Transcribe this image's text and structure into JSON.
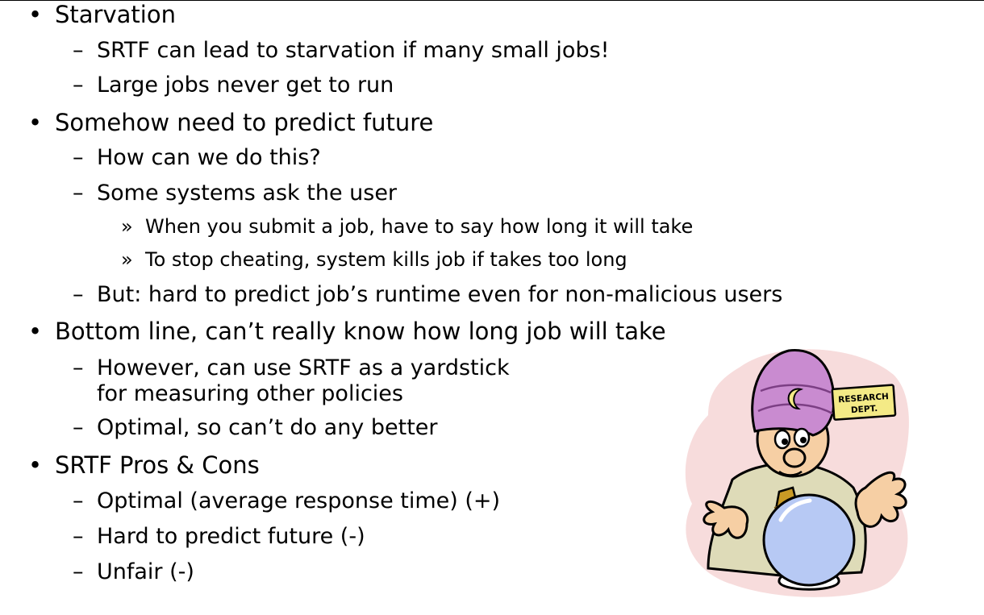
{
  "slide": {
    "items": [
      {
        "level": 1,
        "marker": "•",
        "text": "Starvation"
      },
      {
        "level": 2,
        "marker": "–",
        "text": "SRTF can lead to starvation if many small jobs!"
      },
      {
        "level": 2,
        "marker": "–",
        "text": "Large jobs never get to run"
      },
      {
        "level": 1,
        "marker": "•",
        "text": "Somehow need to predict future"
      },
      {
        "level": 2,
        "marker": "–",
        "text": "How can we do this?"
      },
      {
        "level": 2,
        "marker": "–",
        "text": "Some systems ask the user"
      },
      {
        "level": 3,
        "marker": "»",
        "text": "When you submit a job, have to say how long it will take"
      },
      {
        "level": 3,
        "marker": "»",
        "text": "To stop cheating, system kills job if takes too long"
      },
      {
        "level": 2,
        "marker": "–",
        "text": "But: hard to predict job’s runtime even for non-malicious users"
      },
      {
        "level": 1,
        "marker": "•",
        "text": "Bottom line, can’t really know how long job will take"
      },
      {
        "level": 2,
        "marker": "–",
        "text": "However, can use SRTF as a yardstick",
        "continuation": "for measuring other policies"
      },
      {
        "level": 2,
        "marker": "–",
        "text": "Optimal, so can’t do any better"
      },
      {
        "level": 1,
        "marker": "•",
        "text": "SRTF Pros & Cons"
      },
      {
        "level": 2,
        "marker": "–",
        "text": "Optimal (average response time) (+)"
      },
      {
        "level": 2,
        "marker": "–",
        "text": "Hard to predict future (-)"
      },
      {
        "level": 2,
        "marker": "–",
        "text": "Unfair (-)"
      }
    ]
  },
  "clipart": {
    "sign_line1": "RESEARCH",
    "sign_line2": "DEPT.",
    "icon": "fortune-teller-crystal-ball-icon"
  },
  "colors": {
    "turban": "#c98bd0",
    "background_blob": "#f7dcdc",
    "crystal_ball": "#b7c9f4",
    "sign": "#f4ea86",
    "suit": "#dedbb8",
    "skin": "#f6cfa4",
    "tie": "#c99a25"
  }
}
